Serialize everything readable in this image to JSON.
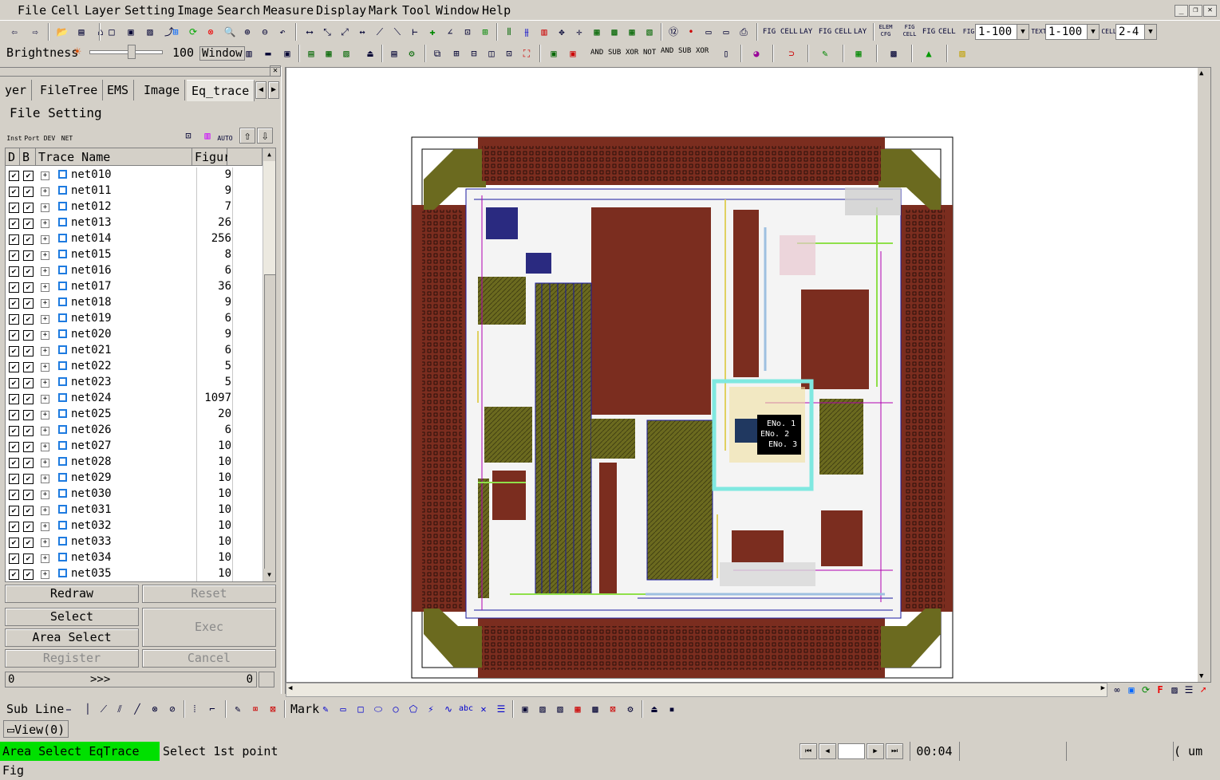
{
  "menu": [
    "File",
    "Cell",
    "Layer",
    "Setting",
    "Image",
    "Search",
    "Measure",
    "Display",
    "Mark",
    "Tool",
    "Window",
    "Help"
  ],
  "toolbar2": {
    "brightness_label": "Brightness",
    "brightness_value": "100",
    "window_label": "Window",
    "logic_ops": [
      "AND",
      "SUB",
      "XOR",
      "NOT",
      "AND",
      "SUB",
      "XOR"
    ]
  },
  "toolbar1": {
    "zoom_combo_1": "1-100",
    "zoom_combo_2": "1-100",
    "level_combo": "2-4",
    "small_labels": [
      "FIG",
      "CELL",
      "LAY",
      "FIG",
      "CELL",
      "LAY",
      "ELEM CFG",
      "FIG CELL",
      "FIG",
      "CELL",
      "FIG",
      "TEXT",
      "CELL"
    ]
  },
  "left_panel": {
    "tabs": [
      "yer",
      "FileTree",
      "EMS",
      "Image",
      "Eq_trace"
    ],
    "file_setting_label": "File Setting",
    "tool_icons": [
      "Inst",
      "Port",
      "DEV",
      "NET",
      "AUTO"
    ],
    "columns": [
      "D",
      "B",
      "Trace Name",
      "Figur"
    ],
    "rows": [
      {
        "name": "net010",
        "fig": "9"
      },
      {
        "name": "net011",
        "fig": "9"
      },
      {
        "name": "net012",
        "fig": "7"
      },
      {
        "name": "net013",
        "fig": "26"
      },
      {
        "name": "net014",
        "fig": "256"
      },
      {
        "name": "net015",
        "fig": "8"
      },
      {
        "name": "net016",
        "fig": "6"
      },
      {
        "name": "net017",
        "fig": "36"
      },
      {
        "name": "net018",
        "fig": "9"
      },
      {
        "name": "net019",
        "fig": "6"
      },
      {
        "name": "net020",
        "fig": "9"
      },
      {
        "name": "net021",
        "fig": "6"
      },
      {
        "name": "net022",
        "fig": "5"
      },
      {
        "name": "net023",
        "fig": "5"
      },
      {
        "name": "net024",
        "fig": "1097"
      },
      {
        "name": "net025",
        "fig": "20"
      },
      {
        "name": "net026",
        "fig": "6"
      },
      {
        "name": "net027",
        "fig": "10"
      },
      {
        "name": "net028",
        "fig": "10"
      },
      {
        "name": "net029",
        "fig": "10"
      },
      {
        "name": "net030",
        "fig": "10"
      },
      {
        "name": "net031",
        "fig": "10"
      },
      {
        "name": "net032",
        "fig": "10"
      },
      {
        "name": "net033",
        "fig": "10"
      },
      {
        "name": "net034",
        "fig": "10"
      },
      {
        "name": "net035",
        "fig": "10"
      }
    ],
    "buttons": {
      "redraw": "Redraw",
      "reset": "Reset",
      "select": "Select",
      "area_select": "Area Select",
      "exec": "Exec",
      "register": "Register",
      "cancel": "Cancel"
    },
    "progress": {
      "left": "0",
      "mid": ">>>",
      "right": "0"
    }
  },
  "canvas": {
    "markers": [
      {
        "label": "ENo. 1"
      },
      {
        "label": "ENo. 2"
      },
      {
        "label": "ENo. 3"
      }
    ]
  },
  "bottom_toolbar": {
    "subline_label": "Sub Line",
    "mark_label": "Mark",
    "abc": "abc"
  },
  "view_tab": "View(0)",
  "status": {
    "mode": "Area Select EqTrace Fig",
    "message": "Select 1st point",
    "time": "00:04",
    "unit": "( um"
  },
  "colors": {
    "mode_bg": "#00e000",
    "pad_brown": "#7b2d1f",
    "metal_olive": "#6b6a1f",
    "trace_blue": "#1a1aa0",
    "highlight_cyan": "#7fe8e0"
  }
}
